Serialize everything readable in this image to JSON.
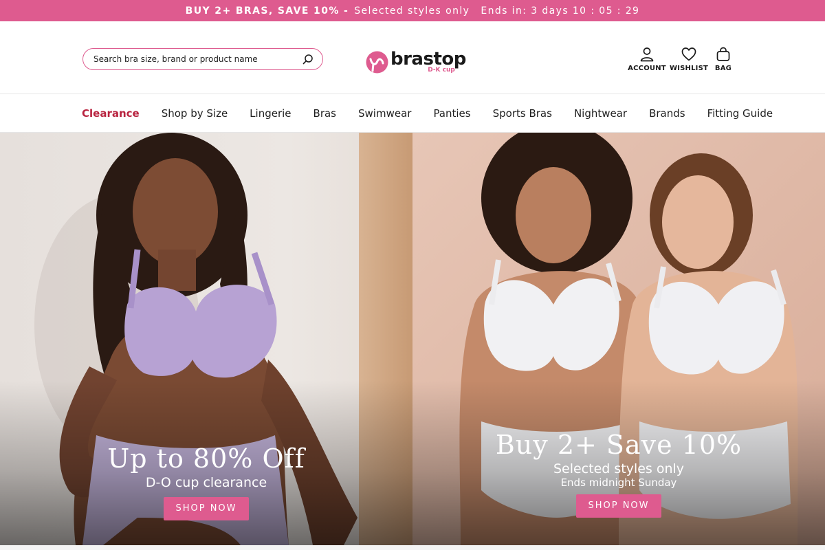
{
  "promo": {
    "bold": "BUY 2+ BRAS, SAVE 10% -",
    "text": "Selected styles only",
    "countdown": "Ends in: 3 days 10 : 05 : 29"
  },
  "search": {
    "placeholder": "Search bra size, brand or product name"
  },
  "logo": {
    "wordmark": "brastop",
    "sub": "D-K cup"
  },
  "header_actions": {
    "account": "ACCOUNT",
    "wishlist": "WISHLIST",
    "bag": "BAG"
  },
  "nav": {
    "items": [
      "Clearance",
      "Shop by Size",
      "Lingerie",
      "Bras",
      "Swimwear",
      "Panties",
      "Sports Bras",
      "Nightwear",
      "Brands",
      "Fitting Guide"
    ]
  },
  "hero": {
    "left": {
      "headline": "Up to 80% Off",
      "subline": "D-O cup clearance",
      "cta": "SHOP NOW"
    },
    "right": {
      "headline": "Buy 2+ Save 10%",
      "subline": "Selected styles only",
      "smallline": "Ends midnight Sunday",
      "cta": "SHOP NOW"
    }
  },
  "colors": {
    "accent": "#de5b8f",
    "clearance": "#b8233f"
  },
  "icons": {
    "search": "search-icon",
    "account": "user-icon",
    "wishlist": "heart-icon",
    "bag": "bag-icon"
  }
}
